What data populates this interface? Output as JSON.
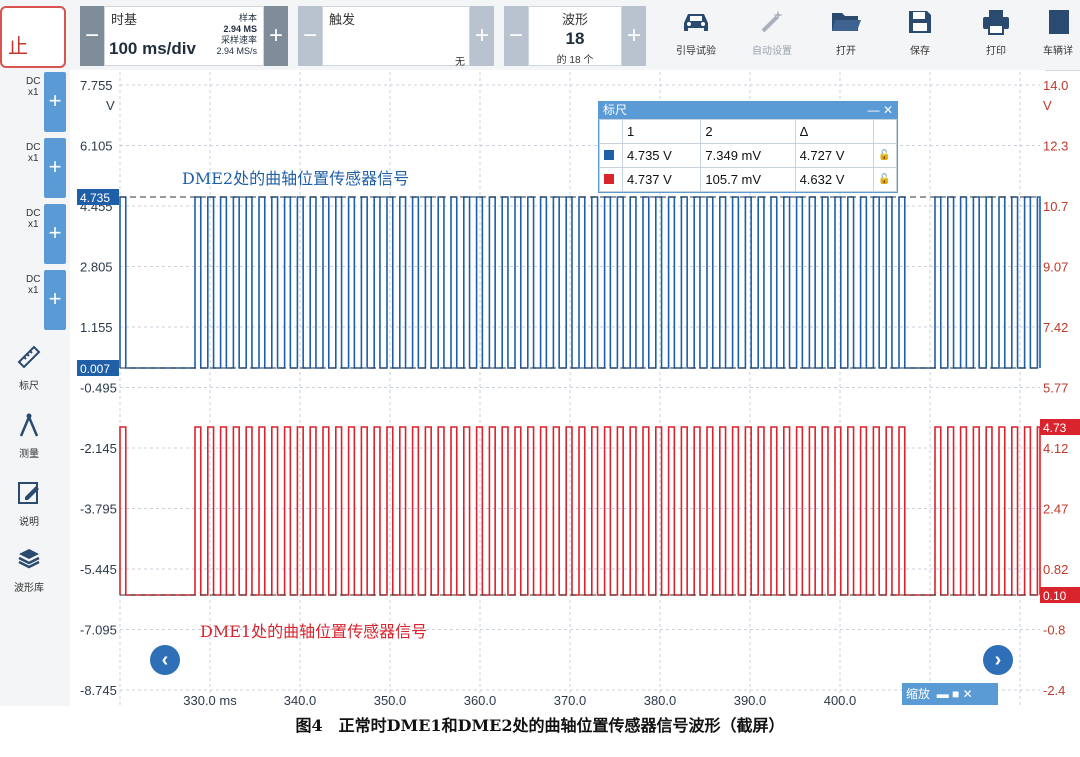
{
  "toolbar": {
    "left_text": "止",
    "timebase": {
      "label": "时基",
      "value": "100 ms/div",
      "samples_label": "样本",
      "samples": "2.94 MS",
      "rate_label": "采样速率",
      "rate": "2.94 MS/s"
    },
    "trigger": {
      "label": "触发",
      "mode": "无"
    },
    "waveform": {
      "label": "波形",
      "count": "18",
      "of": "的 18 个"
    },
    "buttons": [
      "引导试验",
      "自动设置",
      "打开",
      "保存",
      "打印",
      "车辆详"
    ]
  },
  "channels": [
    {
      "dc": "DC",
      "scale": "x1"
    },
    {
      "dc": "DC",
      "scale": "x1"
    },
    {
      "dc": "DC",
      "scale": "x1"
    },
    {
      "dc": "DC",
      "scale": "x1"
    }
  ],
  "tools": [
    "标尺",
    "测量",
    "说明",
    "波形库"
  ],
  "ruler": {
    "title": "标尺",
    "headers": [
      "1",
      "2",
      "Δ"
    ],
    "rows": [
      {
        "color": "#1f5fa8",
        "v1": "4.735 V",
        "v2": "7.349 mV",
        "delta": "4.727 V"
      },
      {
        "color": "#d9232d",
        "v1": "4.737 V",
        "v2": "105.7 mV",
        "delta": "4.632 V"
      }
    ]
  },
  "chart_data": {
    "type": "line",
    "left_axis": {
      "unit": "V",
      "ticks": [
        "7.755",
        "6.105",
        "4.455",
        "2.805",
        "1.155",
        "-0.495",
        "-2.145",
        "-3.795",
        "-5.445",
        "-7.095",
        "-8.745"
      ]
    },
    "right_axis": {
      "unit": "V",
      "ticks": [
        "14.0",
        "12.3",
        "10.7",
        "9.07",
        "7.42",
        "5.77",
        "4.12",
        "2.47",
        "0.82",
        "-0.8",
        "-2.4"
      ]
    },
    "x_ticks": [
      "330.0 ms",
      "340.0",
      "350.0",
      "360.0",
      "370.0",
      "380.0",
      "390.0",
      "400.0"
    ],
    "markers": {
      "blue_high": "4.735",
      "blue_low": "0.007",
      "red_high": "4.73",
      "red_low": "0.10"
    },
    "series": [
      {
        "name": "DME2处的曲轴位置传感器信号",
        "color": "#1f5fa8",
        "high": 4.735,
        "low": 0.007
      },
      {
        "name": "DME1处的曲轴位置传感器信号",
        "color": "#d9232d",
        "high": 4.737,
        "low": 0.105
      }
    ]
  },
  "zoom_label": "缩放",
  "caption": "图4　正常时DME1和DME2处的曲轴位置传感器信号波形（截屏）"
}
